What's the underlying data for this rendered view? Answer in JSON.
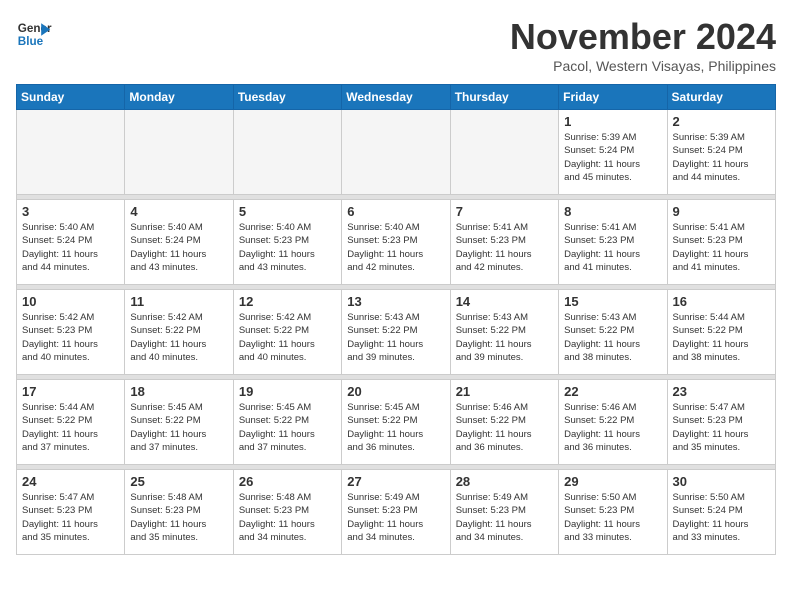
{
  "header": {
    "logo_line1": "General",
    "logo_line2": "Blue",
    "month": "November 2024",
    "location": "Pacol, Western Visayas, Philippines"
  },
  "days_of_week": [
    "Sunday",
    "Monday",
    "Tuesday",
    "Wednesday",
    "Thursday",
    "Friday",
    "Saturday"
  ],
  "weeks": [
    [
      {
        "day": "",
        "info": ""
      },
      {
        "day": "",
        "info": ""
      },
      {
        "day": "",
        "info": ""
      },
      {
        "day": "",
        "info": ""
      },
      {
        "day": "",
        "info": ""
      },
      {
        "day": "1",
        "info": "Sunrise: 5:39 AM\nSunset: 5:24 PM\nDaylight: 11 hours\nand 45 minutes."
      },
      {
        "day": "2",
        "info": "Sunrise: 5:39 AM\nSunset: 5:24 PM\nDaylight: 11 hours\nand 44 minutes."
      }
    ],
    [
      {
        "day": "3",
        "info": "Sunrise: 5:40 AM\nSunset: 5:24 PM\nDaylight: 11 hours\nand 44 minutes."
      },
      {
        "day": "4",
        "info": "Sunrise: 5:40 AM\nSunset: 5:24 PM\nDaylight: 11 hours\nand 43 minutes."
      },
      {
        "day": "5",
        "info": "Sunrise: 5:40 AM\nSunset: 5:23 PM\nDaylight: 11 hours\nand 43 minutes."
      },
      {
        "day": "6",
        "info": "Sunrise: 5:40 AM\nSunset: 5:23 PM\nDaylight: 11 hours\nand 42 minutes."
      },
      {
        "day": "7",
        "info": "Sunrise: 5:41 AM\nSunset: 5:23 PM\nDaylight: 11 hours\nand 42 minutes."
      },
      {
        "day": "8",
        "info": "Sunrise: 5:41 AM\nSunset: 5:23 PM\nDaylight: 11 hours\nand 41 minutes."
      },
      {
        "day": "9",
        "info": "Sunrise: 5:41 AM\nSunset: 5:23 PM\nDaylight: 11 hours\nand 41 minutes."
      }
    ],
    [
      {
        "day": "10",
        "info": "Sunrise: 5:42 AM\nSunset: 5:23 PM\nDaylight: 11 hours\nand 40 minutes."
      },
      {
        "day": "11",
        "info": "Sunrise: 5:42 AM\nSunset: 5:22 PM\nDaylight: 11 hours\nand 40 minutes."
      },
      {
        "day": "12",
        "info": "Sunrise: 5:42 AM\nSunset: 5:22 PM\nDaylight: 11 hours\nand 40 minutes."
      },
      {
        "day": "13",
        "info": "Sunrise: 5:43 AM\nSunset: 5:22 PM\nDaylight: 11 hours\nand 39 minutes."
      },
      {
        "day": "14",
        "info": "Sunrise: 5:43 AM\nSunset: 5:22 PM\nDaylight: 11 hours\nand 39 minutes."
      },
      {
        "day": "15",
        "info": "Sunrise: 5:43 AM\nSunset: 5:22 PM\nDaylight: 11 hours\nand 38 minutes."
      },
      {
        "day": "16",
        "info": "Sunrise: 5:44 AM\nSunset: 5:22 PM\nDaylight: 11 hours\nand 38 minutes."
      }
    ],
    [
      {
        "day": "17",
        "info": "Sunrise: 5:44 AM\nSunset: 5:22 PM\nDaylight: 11 hours\nand 37 minutes."
      },
      {
        "day": "18",
        "info": "Sunrise: 5:45 AM\nSunset: 5:22 PM\nDaylight: 11 hours\nand 37 minutes."
      },
      {
        "day": "19",
        "info": "Sunrise: 5:45 AM\nSunset: 5:22 PM\nDaylight: 11 hours\nand 37 minutes."
      },
      {
        "day": "20",
        "info": "Sunrise: 5:45 AM\nSunset: 5:22 PM\nDaylight: 11 hours\nand 36 minutes."
      },
      {
        "day": "21",
        "info": "Sunrise: 5:46 AM\nSunset: 5:22 PM\nDaylight: 11 hours\nand 36 minutes."
      },
      {
        "day": "22",
        "info": "Sunrise: 5:46 AM\nSunset: 5:22 PM\nDaylight: 11 hours\nand 36 minutes."
      },
      {
        "day": "23",
        "info": "Sunrise: 5:47 AM\nSunset: 5:23 PM\nDaylight: 11 hours\nand 35 minutes."
      }
    ],
    [
      {
        "day": "24",
        "info": "Sunrise: 5:47 AM\nSunset: 5:23 PM\nDaylight: 11 hours\nand 35 minutes."
      },
      {
        "day": "25",
        "info": "Sunrise: 5:48 AM\nSunset: 5:23 PM\nDaylight: 11 hours\nand 35 minutes."
      },
      {
        "day": "26",
        "info": "Sunrise: 5:48 AM\nSunset: 5:23 PM\nDaylight: 11 hours\nand 34 minutes."
      },
      {
        "day": "27",
        "info": "Sunrise: 5:49 AM\nSunset: 5:23 PM\nDaylight: 11 hours\nand 34 minutes."
      },
      {
        "day": "28",
        "info": "Sunrise: 5:49 AM\nSunset: 5:23 PM\nDaylight: 11 hours\nand 34 minutes."
      },
      {
        "day": "29",
        "info": "Sunrise: 5:50 AM\nSunset: 5:23 PM\nDaylight: 11 hours\nand 33 minutes."
      },
      {
        "day": "30",
        "info": "Sunrise: 5:50 AM\nSunset: 5:24 PM\nDaylight: 11 hours\nand 33 minutes."
      }
    ]
  ]
}
